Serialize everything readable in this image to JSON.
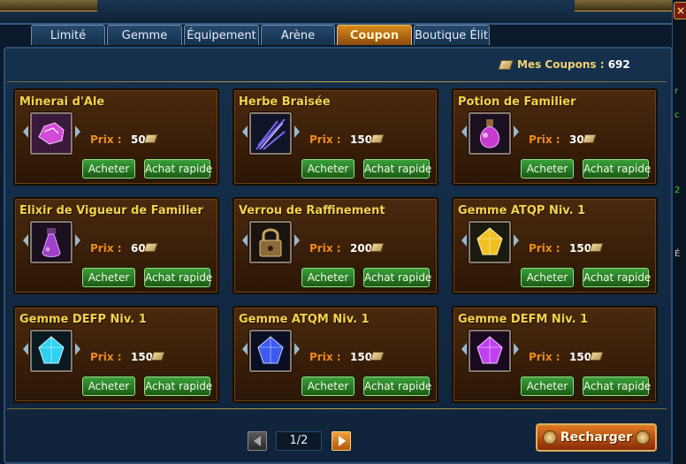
{
  "tabs": [
    {
      "label": "Limité",
      "active": false
    },
    {
      "label": "Gemme",
      "active": false
    },
    {
      "label": "Équipement",
      "active": false
    },
    {
      "label": "Arène",
      "active": false
    },
    {
      "label": "Coupon",
      "active": true
    },
    {
      "label": "Boutique Élite",
      "active": false
    }
  ],
  "coupons": {
    "label": "Mes Coupons :",
    "value": "692",
    "icon": "coupon-icon"
  },
  "items": [
    {
      "name": "Minerai d'Ale",
      "price_label": "Prix :",
      "price": "50",
      "icon": "ore-icon",
      "color": "#d24ad8"
    },
    {
      "name": "Herbe Braisée",
      "price_label": "Prix :",
      "price": "150",
      "icon": "herb-icon",
      "color": "#7a6af0"
    },
    {
      "name": "Potion de Familier",
      "price_label": "Prix :",
      "price": "30",
      "icon": "potion-icon",
      "color": "#c83ad0"
    },
    {
      "name": "Élixir de Vigueur de Familier",
      "price_label": "Prix :",
      "price": "60",
      "icon": "elixir-icon",
      "color": "#a040c8"
    },
    {
      "name": "Verrou de Raffinement",
      "price_label": "Prix :",
      "price": "200",
      "icon": "lock-icon",
      "color": "#8a6a3a"
    },
    {
      "name": "Gemme ATQP Niv. 1",
      "price_label": "Prix :",
      "price": "150",
      "icon": "yellow-gem-icon",
      "color": "#f0c020"
    },
    {
      "name": "Gemme DÉFP Niv. 1",
      "price_label": "Prix :",
      "price": "150",
      "icon": "cyan-gem-icon",
      "color": "#30d0f0"
    },
    {
      "name": "Gemme ATQM Niv. 1",
      "price_label": "Prix :",
      "price": "150",
      "icon": "blue-gem-icon",
      "color": "#3a5af0"
    },
    {
      "name": "Gemme DÉFM Niv. 1",
      "price_label": "Prix :",
      "price": "150",
      "icon": "purple-gem-icon",
      "color": "#c040f0"
    }
  ],
  "buttons": {
    "buy": "Acheter",
    "quick_buy": "Achat rapide",
    "reload": "Recharger"
  },
  "pagination": {
    "current": "1/2"
  },
  "colors": {
    "accent": "#f4d24c",
    "price_label": "#f08a1a",
    "button": "#2a8a2a",
    "tab_active": "#d98a1c"
  }
}
